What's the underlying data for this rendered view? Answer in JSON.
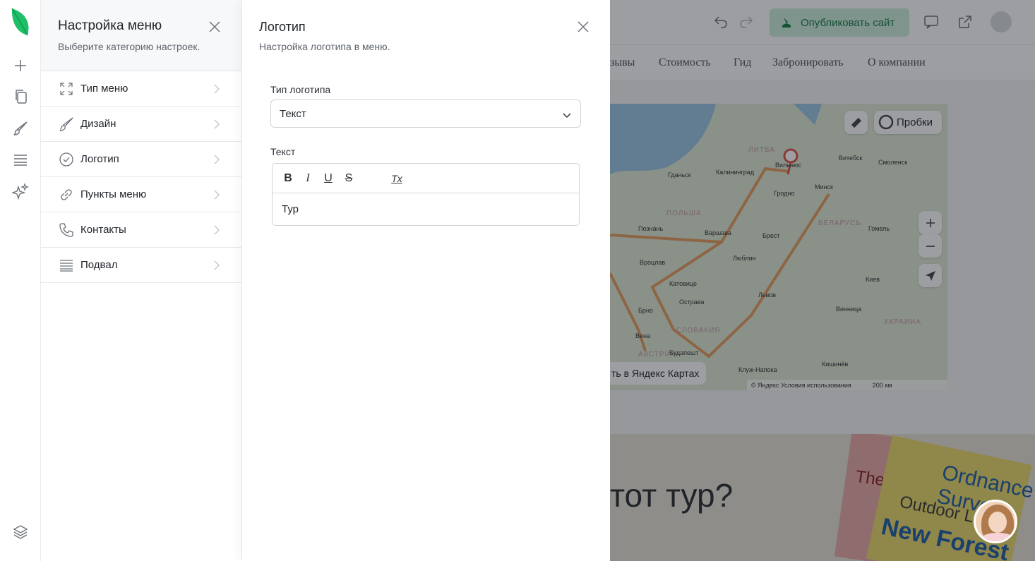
{
  "rail": {
    "tools": [
      "add-icon",
      "pages-icon",
      "brush-icon",
      "sections-icon",
      "sparkles-icon",
      "layers-icon"
    ]
  },
  "menu_panel": {
    "title": "Настройка меню",
    "subtitle": "Выберите категорию настроек.",
    "items": [
      {
        "label": "Тип меню",
        "icon": "expand-icon"
      },
      {
        "label": "Дизайн",
        "icon": "brush-icon"
      },
      {
        "label": "Логотип",
        "icon": "badge-check-icon"
      },
      {
        "label": "Пункты меню",
        "icon": "link-icon"
      },
      {
        "label": "Контакты",
        "icon": "phone-icon"
      },
      {
        "label": "Подвал",
        "icon": "footer-lines-icon"
      }
    ]
  },
  "logo_panel": {
    "title": "Логотип",
    "subtitle": "Настройка логотипа в меню.",
    "logo_type_label": "Тип логотипа",
    "logo_type_value": "Текст",
    "text_label": "Текст",
    "editor": {
      "buttons": [
        "B",
        "I",
        "U",
        "S",
        "Tx"
      ],
      "content": "Тур"
    }
  },
  "background_site": {
    "publish_label": "Опубликовать сайт",
    "nav_items": [
      "зывы",
      "Стоимость",
      "Гид",
      "Забронировать",
      "О компании"
    ],
    "map": {
      "traffic_label": "Пробки",
      "open_link": "ть в Яндекс Картах",
      "copyright": "© Яндекс  Условия использования",
      "scale": "200 км",
      "cities": [
        "Вильнюс",
        "Витебск",
        "Смоленск",
        "Гданьск",
        "Калининград",
        "Гродно",
        "Минск",
        "Познань",
        "Варшава",
        "Брест",
        "Гомель",
        "Вроцлав",
        "Люблин",
        "Катовице",
        "Острава",
        "Львов",
        "Киев",
        "Брно",
        "Винница",
        "Вена",
        "Будапешт",
        "Кишинёв",
        "Клуж-Напока"
      ],
      "countries": [
        "ЛИТВА",
        "ПОЛЬША",
        "БЕЛАРУСЬ",
        "СЛОВАКИЯ",
        "УКРАИНА",
        "АВСТРИЯ"
      ]
    },
    "hero_heading": "тот тур?",
    "hero_map_texts": [
      "Ordnance Survey",
      "Outdoor Le",
      "New Forest",
      "The"
    ]
  },
  "colors": {
    "brand_green": "#1fbf6a",
    "publish_bg": "#cdeedd",
    "publish_text": "#1b7a47",
    "route": "#e8914a"
  }
}
